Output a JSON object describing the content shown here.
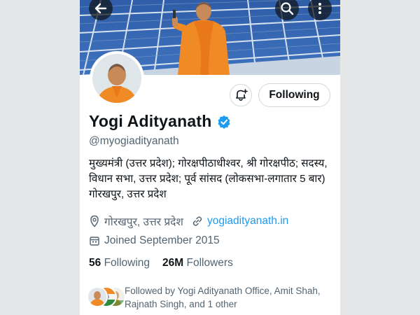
{
  "banner": {
    "back_icon": "arrow-left-icon",
    "search_icon": "search-icon",
    "more_icon": "more-vertical-icon"
  },
  "profile": {
    "name": "Yogi Adityanath",
    "handle": "@myogiadityanath",
    "verified": true,
    "bio_lines": [
      "मुख्यमंत्री (उत्तर प्रदेश); गोरक्षपीठाधीश्वर, श्री गोरक्षपीठ; सदस्य,",
      "विधान सभा, उत्तर प्रदेश; पूर्व सांसद (लोकसभा-लगातार 5 बार)",
      "गोरखपुर, उत्तर प्रदेश"
    ],
    "location": "गोरखपुर, उत्तर प्रदेश",
    "website": "yogiadityanath.in",
    "joined": "Joined September 2015",
    "following_count": "56",
    "following_label": "Following",
    "followers_count": "26M",
    "followers_label": "Followers"
  },
  "actions": {
    "notify_icon": "bell-plus-icon",
    "follow_button_label": "Following"
  },
  "followed_by": {
    "line1": "Followed by Yogi Adityanath Office, Amit Shah,",
    "line2": "Rajnath Singh, and 1 other"
  },
  "colors": {
    "accent": "#1d9bf0",
    "text": "#0f1419",
    "secondary": "#536471",
    "saffron": "#f08a24"
  }
}
